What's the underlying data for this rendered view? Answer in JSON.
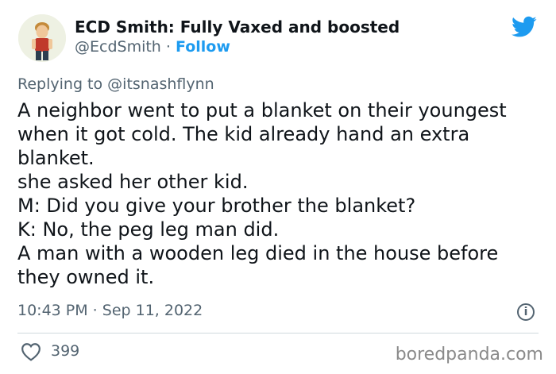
{
  "header": {
    "display_name": "ECD Smith: Fully Vaxed and boosted",
    "handle": "@EcdSmith",
    "separator": "·",
    "follow_label": "Follow"
  },
  "reply": {
    "prefix": "Replying to",
    "handle": "@itsnashflynn"
  },
  "tweet": {
    "lines": [
      "A neighbor went to put a blanket on their youngest",
      "when it got cold. The kid already hand an extra",
      "blanket.",
      "she asked her other kid.",
      "M: Did you give your brother the blanket?",
      "K: No, the peg leg man did.",
      "A man with a wooden leg died in the house before",
      "they owned it."
    ]
  },
  "meta": {
    "timestamp": "10:43 PM · Sep 11, 2022",
    "info_glyph": "i"
  },
  "actions": {
    "likes": "399"
  },
  "watermark": "boredpanda.com",
  "colors": {
    "brand_blue": "#1d9bf0",
    "text_primary": "#0f1419",
    "text_secondary": "#536471",
    "divider": "#cfd9de"
  },
  "icons": {
    "avatar": "avatar-cartoon-man",
    "brand": "twitter-bird-icon",
    "info": "info-icon",
    "like": "heart-icon"
  }
}
